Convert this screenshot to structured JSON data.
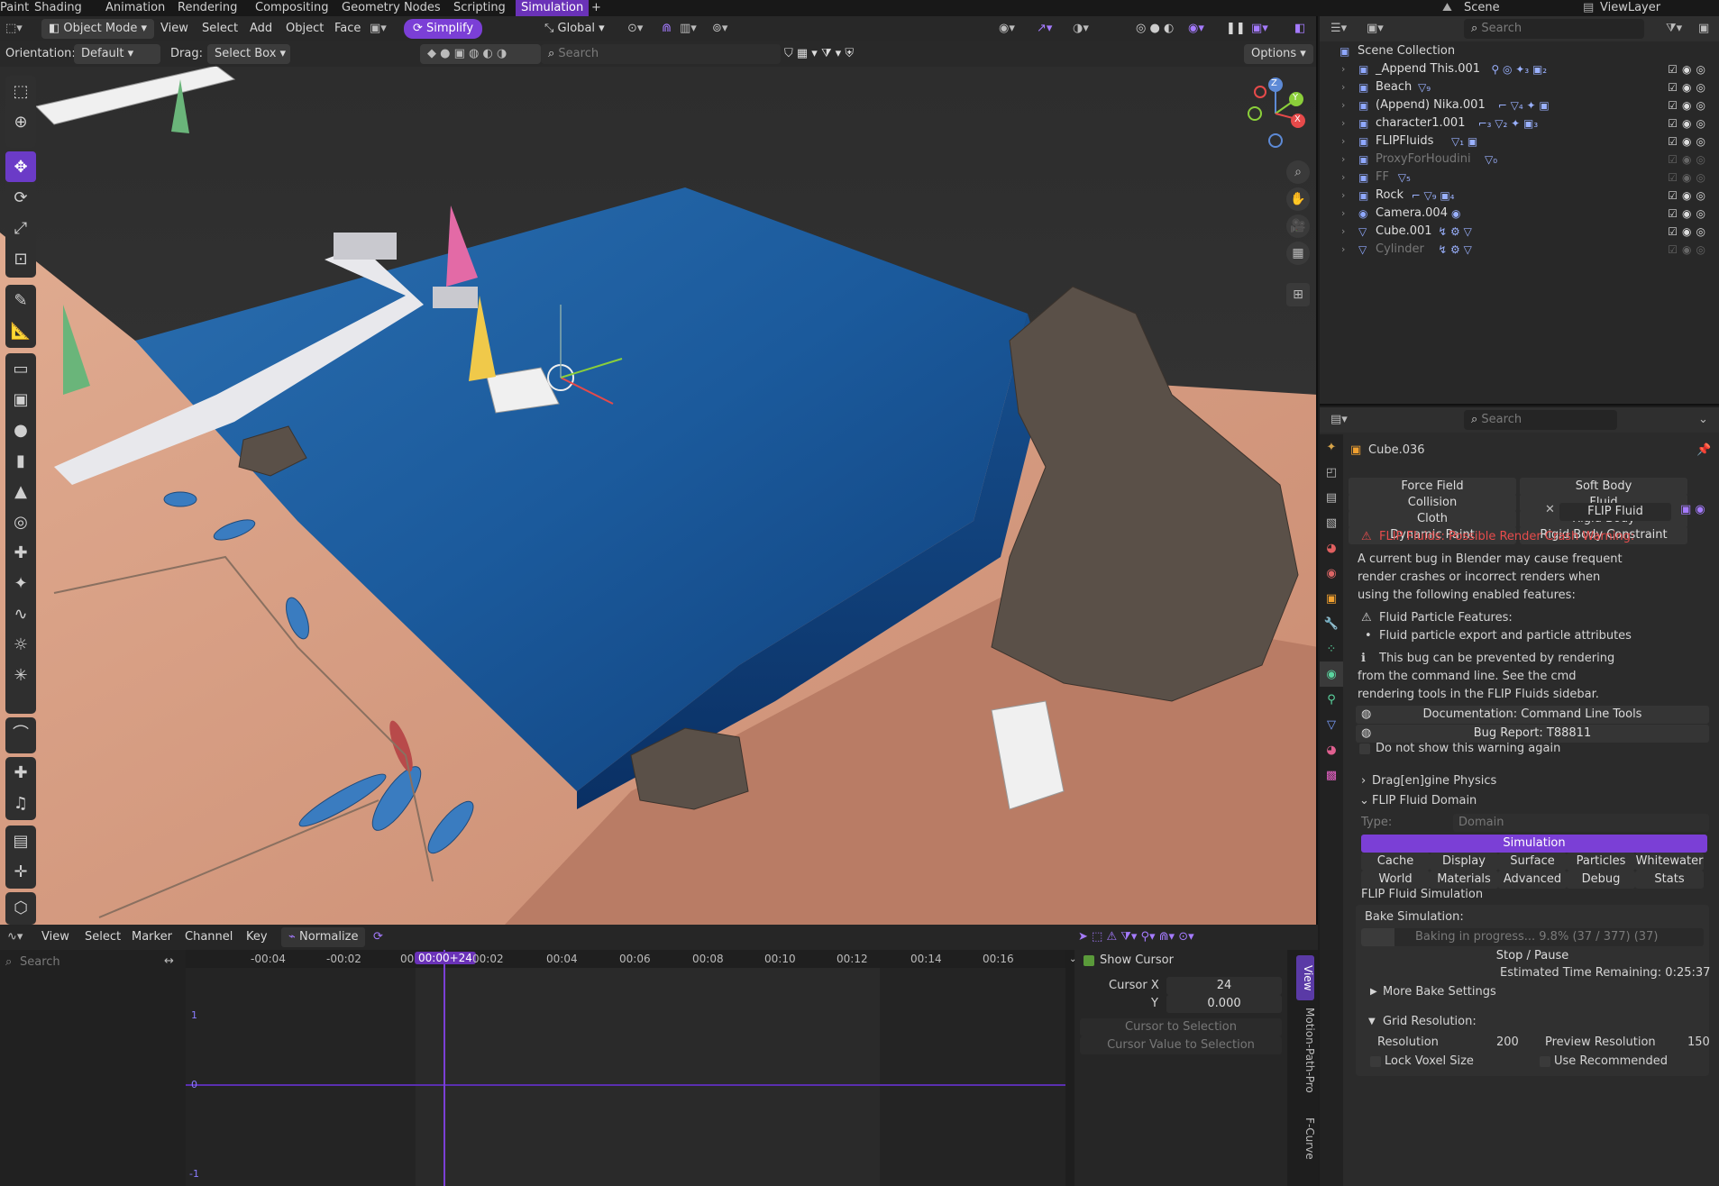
{
  "topbar": {
    "tabs": [
      "Paint",
      "Shading",
      "Animation",
      "Rendering",
      "Compositing",
      "Geometry Nodes",
      "Scripting",
      "Simulation",
      "+"
    ],
    "active": "Simulation",
    "scene": "Scene",
    "viewlayer": "ViewLayer",
    "search_placeholder": "Search"
  },
  "viewport": {
    "mode": "Object Mode",
    "menus": [
      "View",
      "Select",
      "Add",
      "Object",
      "Face"
    ],
    "simplify": "Simplify",
    "orientation_label": "Orientation:",
    "orientation": "Default",
    "drag_label": "Drag:",
    "drag": "Select Box",
    "transform": "Global",
    "search_placeholder": "Search",
    "options": "Options",
    "gizmo": {
      "x": "X",
      "y": "Y",
      "z": "Z"
    }
  },
  "outliner": {
    "root": "Scene Collection",
    "search_placeholder": "Search",
    "items": [
      {
        "name": "_Append This.001",
        "type": "collection",
        "badges": "⚲ ◎ ✦₃ ▣₂",
        "dim": false
      },
      {
        "name": "Beach",
        "type": "collection",
        "badges": "▽₉",
        "dim": false
      },
      {
        "name": "(Append) Nika.001",
        "type": "collection",
        "badges": "⌐ ▽₄ ✦ ▣",
        "dim": false
      },
      {
        "name": "character1.001",
        "type": "collection",
        "badges": "⌐₃ ▽₂ ✦ ▣₃",
        "dim": false
      },
      {
        "name": "FLIPFluids",
        "type": "collection",
        "badges": "▽₁ ▣",
        "dim": false
      },
      {
        "name": "ProxyForHoudini",
        "type": "collection",
        "badges": "▽₀",
        "dim": true
      },
      {
        "name": "FF",
        "type": "collection",
        "badges": "▽₅",
        "dim": true
      },
      {
        "name": "Rock",
        "type": "collection",
        "badges": "⌐ ▽₉ ▣₄",
        "dim": false
      },
      {
        "name": "Camera.004",
        "type": "camera",
        "badges": "◉",
        "dim": false
      },
      {
        "name": "Cube.001",
        "type": "mesh",
        "badges": "↯ ⚙ ▽",
        "dim": false
      },
      {
        "name": "Cylinder",
        "type": "mesh",
        "badges": "↯ ⚙ ▽",
        "dim": true
      }
    ]
  },
  "props": {
    "search_placeholder": "Search",
    "object": "Cube.036",
    "physics": [
      [
        "Force Field",
        "Soft Body"
      ],
      [
        "Collision",
        "Fluid"
      ],
      [
        "Cloth",
        "Rigid Body"
      ],
      [
        "Dynamic Paint",
        "Rigid Body Constraint"
      ]
    ],
    "flip_fluid": "FLIP Fluid",
    "warning_title": "FLIP Fluids: Possible Render Crash Warning:",
    "warning_lines": [
      "A current bug in Blender may cause frequent",
      "render crashes or incorrect renders when",
      "using the following enabled features:"
    ],
    "feature_title": "Fluid Particle Features:",
    "feature_item": "Fluid particle export and particle attributes",
    "prevent_lines": [
      "This bug can be prevented by rendering",
      "from the command line. See the cmd",
      "rendering tools in the FLIP Fluids sidebar."
    ],
    "doc_btn": "Documentation: Command Line Tools",
    "bug_btn": "Bug Report: T88811",
    "dont_show": "Do not show this warning again",
    "panel1": "Drag[en]gine Physics",
    "panel2": "FLIP Fluid Domain",
    "type_label": "Type:",
    "type_value": "Domain",
    "tabs_row1": [
      "Cache",
      "Display",
      "Surface",
      "Particles",
      "Whitewater"
    ],
    "tabs_row2": [
      "World",
      "Materials",
      "Advanced",
      "Debug",
      "Stats"
    ],
    "simulation_tab": "Simulation",
    "sim_title": "FLIP Fluid Simulation",
    "bake_label": "Bake Simulation:",
    "baking": "Baking in progress...  9.8%  (37 / 377)  (37)",
    "bake_progress": 0.098,
    "stop": "Stop / Pause",
    "remaining": "Estimated Time Remaining:  0:25:37",
    "more_bake": "More Bake Settings",
    "grid_res": "Grid Resolution:",
    "resolution_label": "Resolution",
    "resolution": "200",
    "preview_label": "Preview Resolution",
    "preview": "150",
    "lock_voxel": "Lock Voxel Size",
    "use_rec": "Use Recommended"
  },
  "graph": {
    "menus": [
      "View",
      "Select",
      "Marker",
      "Channel",
      "Key"
    ],
    "normalize": "Normalize",
    "search_placeholder": "Search",
    "ticks": [
      "-00:04",
      "-00:02",
      "00",
      "00:00+24",
      "00:02",
      "00:04",
      "00:06",
      "00:08",
      "00:10",
      "00:12",
      "00:14",
      "00:16"
    ],
    "yticks": [
      "1",
      "0",
      "-1"
    ],
    "show_cursor": "Show Cursor",
    "cursor_x_label": "Cursor X",
    "cursor_x": "24",
    "y_label": "Y",
    "y_value": "0.000",
    "cursor_to_sel": "Cursor to Selection",
    "cursor_val": "Cursor Value to Selection",
    "side_tabs": [
      "View",
      "Motion-Path-Pro",
      "F-Curve"
    ]
  }
}
